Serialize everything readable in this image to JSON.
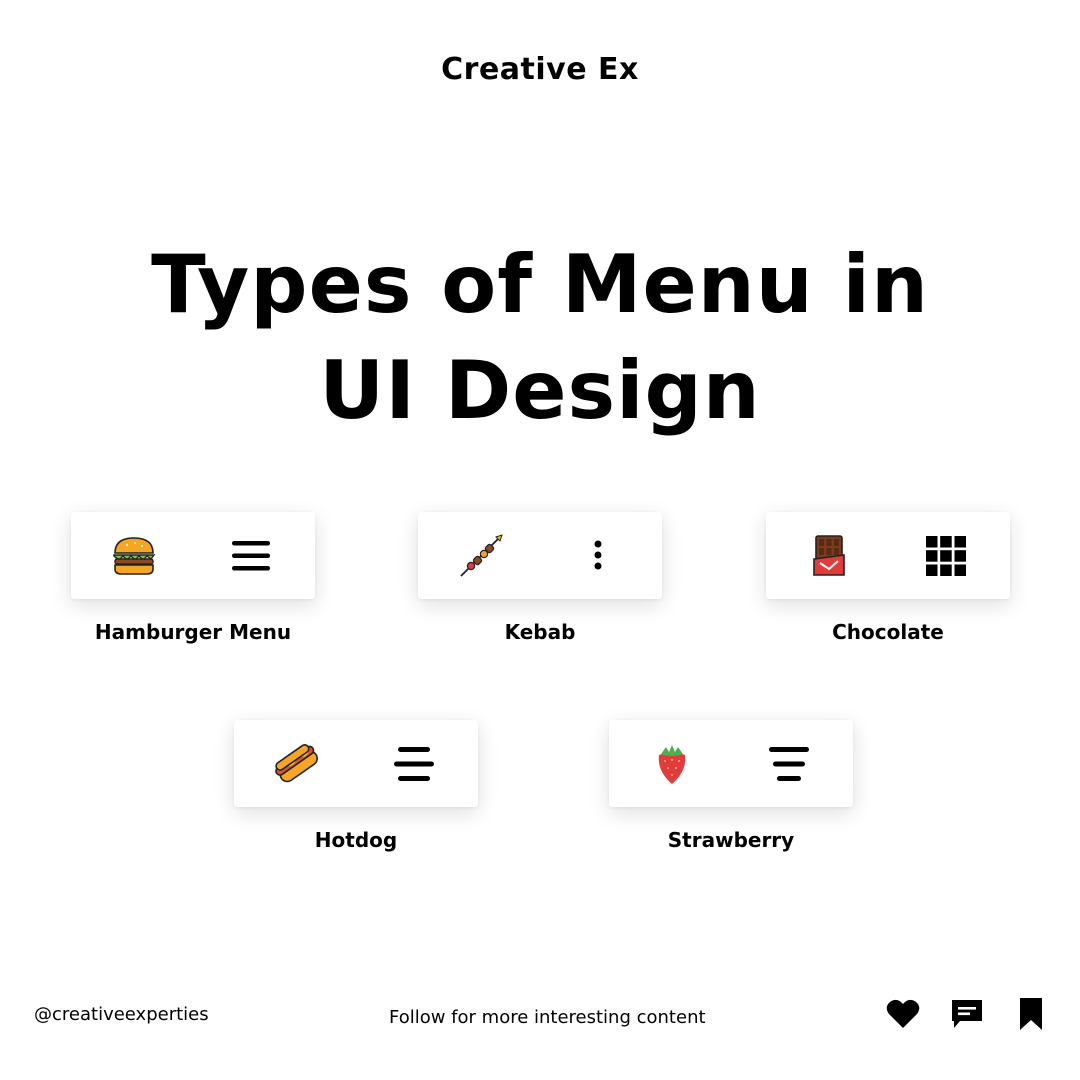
{
  "brand": "Creative Ex",
  "headline": {
    "line1": "Types of Menu in",
    "line2": "UI Design"
  },
  "menus": [
    {
      "label": "Hamburger Menu",
      "food_icon": "hamburger-icon",
      "menu_icon": "hamburger-menu-icon"
    },
    {
      "label": "Kebab",
      "food_icon": "kebab-icon",
      "menu_icon": "kebab-menu-icon"
    },
    {
      "label": "Chocolate",
      "food_icon": "chocolate-icon",
      "menu_icon": "chocolate-menu-icon"
    },
    {
      "label": "Hotdog",
      "food_icon": "hotdog-icon",
      "menu_icon": "hotdog-menu-icon"
    },
    {
      "label": "Strawberry",
      "food_icon": "strawberry-icon",
      "menu_icon": "strawberry-menu-icon"
    }
  ],
  "footer": {
    "handle": "@creativeexperties",
    "follow": "Follow for more interesting content",
    "icons": [
      "heart-icon",
      "comment-icon",
      "bookmark-icon"
    ]
  }
}
